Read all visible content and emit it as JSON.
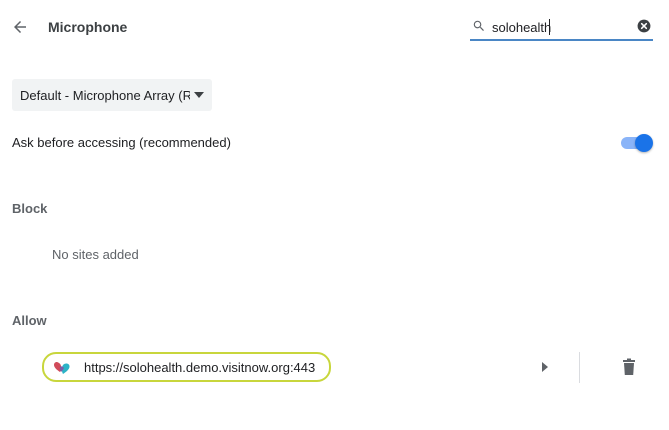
{
  "header": {
    "title": "Microphone",
    "back_icon": "arrow-back-icon",
    "search": {
      "value": "solohealth",
      "icon": "search-icon",
      "clear_icon": "clear-circle-icon"
    }
  },
  "device_select": {
    "selected": "Default - Microphone Array (Re"
  },
  "ask_setting": {
    "label": "Ask before accessing (recommended)",
    "enabled": true
  },
  "block": {
    "heading": "Block",
    "empty_text": "No sites added"
  },
  "allow": {
    "heading": "Allow",
    "sites": [
      {
        "url": "https://solohealth.demo.visitnow.org:443",
        "favicon": "site-heart-favicon"
      }
    ]
  },
  "colors": {
    "accent": "#1a73e8",
    "accent_light": "#8ab4f8",
    "search_underline": "#4a86c5",
    "highlight_outline": "#c8d63c"
  }
}
